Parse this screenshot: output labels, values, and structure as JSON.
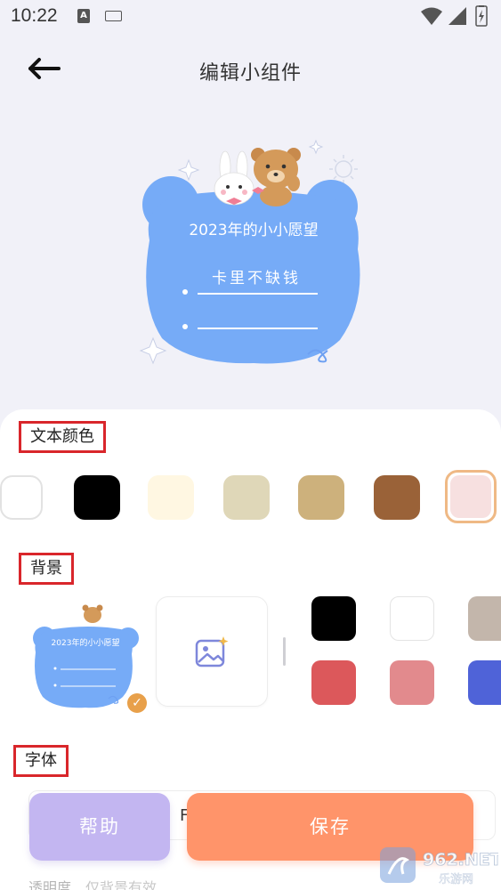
{
  "status_bar": {
    "time": "10:22",
    "notification_letter": "A"
  },
  "header": {
    "title": "编辑小组件"
  },
  "widget_preview": {
    "title": "2023年的小小愿望",
    "wish_line_1": "卡里不缺钱"
  },
  "text_color_section": {
    "label": "文本颜色",
    "swatches": [
      "#ffffff",
      "#000000",
      "#fff7e2",
      "#dfd7b8",
      "#cdb17c",
      "#9a6238",
      "#f7e0e0"
    ],
    "selected_index": 6
  },
  "background_section": {
    "label": "背景",
    "thumb_title": "2023年的小小愿望",
    "swatches": [
      "#000000",
      "#ffffff",
      "#c3b6ab",
      "#dc585b",
      "#e28a8d",
      "#4f63d8"
    ]
  },
  "font_section": {
    "label": "字体",
    "current_value": "F"
  },
  "actions": {
    "help_label": "帮助",
    "save_label": "保存"
  },
  "opacity_section": {
    "label": "透明度",
    "note": "仅背景有效"
  },
  "watermark": {
    "text": "962.NET",
    "subtext": "乐游网"
  }
}
